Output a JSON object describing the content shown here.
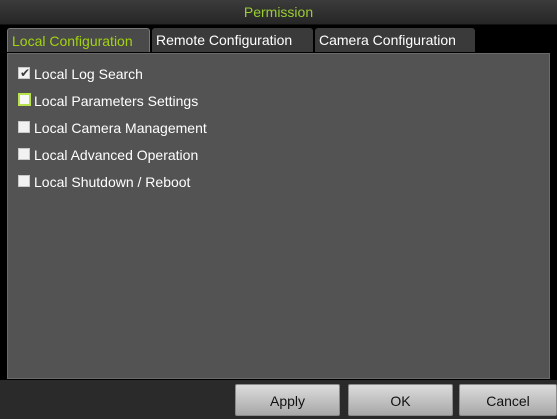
{
  "window": {
    "title": "Permission"
  },
  "tabs": [
    {
      "label": "Local Configuration",
      "active": true
    },
    {
      "label": "Remote Configuration",
      "active": false
    },
    {
      "label": "Camera Configuration",
      "active": false
    }
  ],
  "permissions": [
    {
      "label": "Local Log Search",
      "checked": true,
      "focused": false
    },
    {
      "label": "Local Parameters Settings",
      "checked": false,
      "focused": true
    },
    {
      "label": "Local Camera Management",
      "checked": false,
      "focused": false
    },
    {
      "label": "Local Advanced Operation",
      "checked": false,
      "focused": false
    },
    {
      "label": "Local Shutdown / Reboot",
      "checked": false,
      "focused": false
    }
  ],
  "buttons": {
    "apply": "Apply",
    "ok": "OK",
    "cancel": "Cancel"
  },
  "colors": {
    "accent": "#9acd32",
    "panel": "#535353"
  }
}
